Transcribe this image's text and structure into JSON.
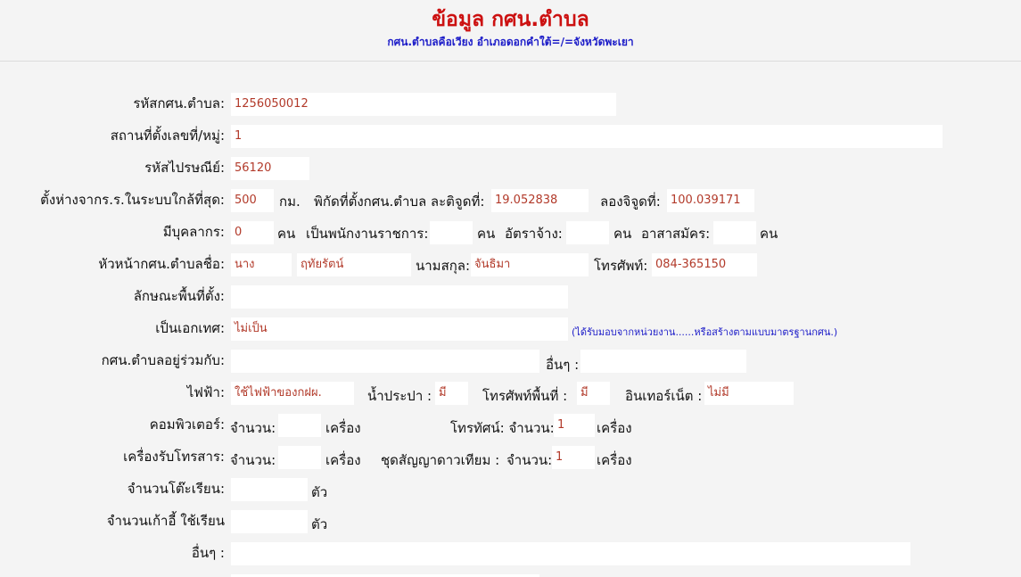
{
  "header": {
    "title": "ข้อมูล กศน.ตำบล",
    "subtitle": "กศน.ตำบลคือเวียง อำเภอดอกคำใต้=/=จังหวัดพะเยา"
  },
  "form": {
    "code_label": "รหัสกศน.ตำบล:",
    "code_value": "1256050012",
    "location_label": "สถานที่ตั้งเลขที่/หมู่:",
    "location_value": "1",
    "postal_label": "รหัสไปรษณีย์:",
    "postal_value": "56120",
    "distance_label": "ตั้งห่างจากร.ร.ในระบบใกล้ที่สุด:",
    "distance_value": "500",
    "distance_unit": "กม.",
    "lat_label": "พิกัดที่ตั้งกศน.ตำบล ละติจูดที่:",
    "lat_value": "19.052838",
    "lon_label": "ลองจิจูดที่:",
    "lon_value": "100.039171",
    "staff_label": "มีบุคลากร:",
    "staff_value": "0",
    "unit_person": "คน",
    "govt_label": "เป็นพนักงานราชการ:",
    "govt_value": "",
    "hired_label": "อัตราจ้าง:",
    "hired_value": "",
    "volunteer_label": "อาสาสมัคร:",
    "volunteer_value": "",
    "head_label": "หัวหน้ากศน.ตำบลชื่อ:",
    "head_prefix": "นาง",
    "head_firstname": "ฤทัยรัตน์",
    "surname_label": "นามสกุล:",
    "surname_value": "จันธิมา",
    "phone_label": "โทรศัพท์:",
    "phone_value": "084-365150",
    "area_label": "ลักษณะพื้นที่ตั้ง:",
    "area_value": "",
    "independent_label": "เป็นเอกเทศ:",
    "independent_value": "ไม่เป็น",
    "independent_note": "(ได้รับมอบจากหน่วยงาน......หรือสร้างตามแบบมาตรฐานกศน.)",
    "shared_label": "กศน.ตำบลอยู่ร่วมกับ:",
    "shared_value": "",
    "other_label": "อื่นๆ :",
    "other_value": "",
    "electric_label": "ไฟฟ้า:",
    "electric_value": "ใช้ไฟฟ้าของกฝผ.",
    "water_label": "น้ำประปา :",
    "water_value": "มี",
    "landline_label": "โทรศัพท์พื้นที่ :",
    "landline_value": "มี",
    "internet_label": "อินเทอร์เน็ต :",
    "internet_value": "ไม่มี",
    "computer_label": "คอมพิวเตอร์:",
    "count_label": "จำนวน:",
    "computer_value": "",
    "unit_machine": "เครื่อง",
    "tv_label": "โทรทัศน์: จำนวน:",
    "tv_value": "1",
    "fax_label": "เครื่องรับโทรสาร:",
    "fax_value": "",
    "satellite_label": "ชุดสัญญาดาวเทียม :",
    "satellite_count_label": "จำนวน:",
    "satellite_value": "1",
    "desks_label": "จำนวนโต๊ะเรียน:",
    "desks_value": "",
    "unit_piece": "ตัว",
    "chairs_label": "จำนวนเก้าอี้ ใช้เรียน",
    "chairs_value": "",
    "others2_label": "อื่นๆ :",
    "others2_value": ""
  }
}
